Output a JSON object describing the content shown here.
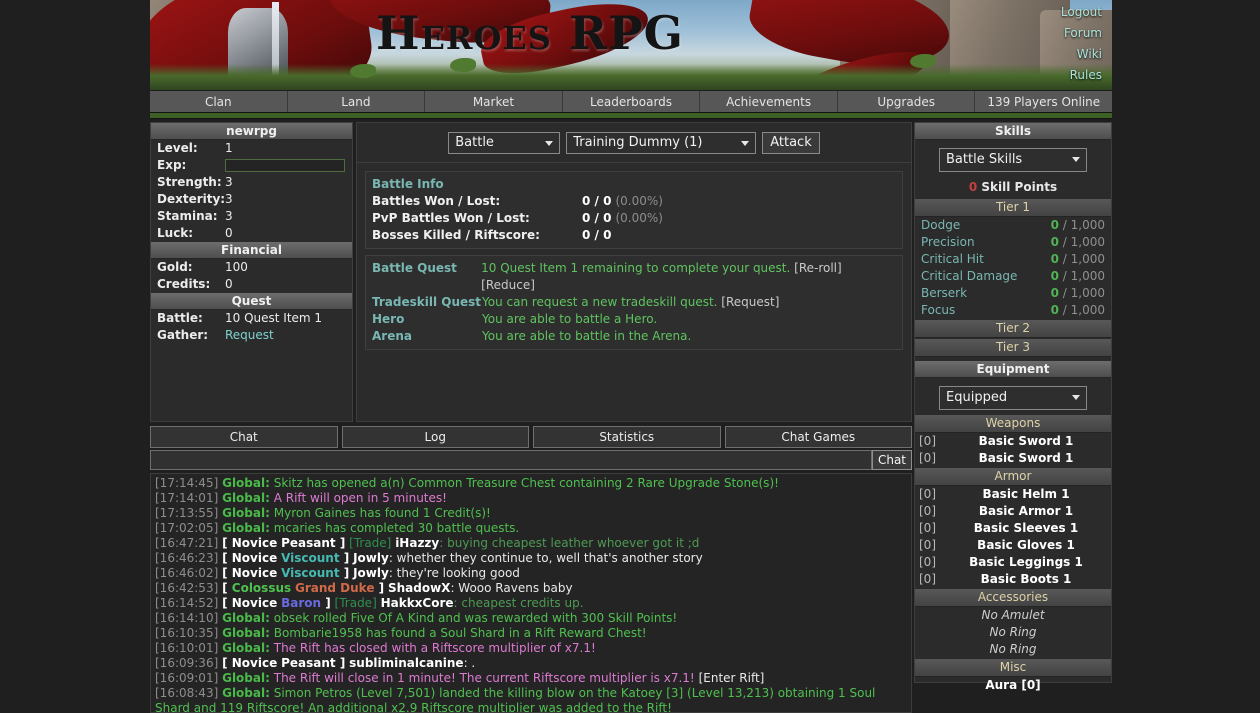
{
  "site": {
    "title": "Heroes RPG"
  },
  "header_links": [
    {
      "label": "Logout"
    },
    {
      "label": "Forum"
    },
    {
      "label": "Wiki"
    },
    {
      "label": "Rules"
    }
  ],
  "nav": [
    {
      "label": "Clan"
    },
    {
      "label": "Land"
    },
    {
      "label": "Market"
    },
    {
      "label": "Leaderboards"
    },
    {
      "label": "Achievements"
    },
    {
      "label": "Upgrades"
    },
    {
      "label": "139 Players Online"
    }
  ],
  "character": {
    "name": "newrpg",
    "stats": [
      {
        "label": "Level:",
        "value": "1"
      },
      {
        "label": "Exp:",
        "value": ""
      },
      {
        "label": "Strength:",
        "value": "3"
      },
      {
        "label": "Dexterity:",
        "value": "3"
      },
      {
        "label": "Stamina:",
        "value": "3"
      },
      {
        "label": "Luck:",
        "value": "0"
      }
    ],
    "financial_header": "Financial",
    "financial": [
      {
        "label": "Gold:",
        "value": "100"
      },
      {
        "label": "Credits:",
        "value": "0"
      }
    ],
    "quest_header": "Quest",
    "quest": [
      {
        "label": "Battle:",
        "value": "10 Quest Item 1",
        "link": false
      },
      {
        "label": "Gather:",
        "value": "Request",
        "link": true
      }
    ]
  },
  "battle": {
    "mode_select": "Battle",
    "target_select": "Training Dummy (1)",
    "attack_label": "Attack",
    "info_title": "Battle Info",
    "info_rows": [
      {
        "label": "Battles Won / Lost:",
        "value": "0 / 0",
        "pct": "(0.00%)"
      },
      {
        "label": "PvP Battles Won / Lost:",
        "value": "0 / 0",
        "pct": "(0.00%)"
      },
      {
        "label": "Bosses Killed / Riftscore:",
        "value": "0 / 0",
        "pct": ""
      }
    ],
    "quest_rows": [
      {
        "label": "Battle Quest",
        "text": "10 Quest Item 1 remaining to complete your quest.",
        "links": [
          "[Re-roll]",
          "[Reduce]"
        ]
      },
      {
        "label": "Tradeskill Quest",
        "text": "You can request a new tradeskill quest.",
        "links": [
          "[Request]"
        ]
      },
      {
        "label": "Hero",
        "text": "You are able to battle a Hero.",
        "links": []
      },
      {
        "label": "Arena",
        "text": "You are able to battle in the Arena.",
        "links": []
      }
    ]
  },
  "skills": {
    "header": "Skills",
    "selected": "Battle Skills",
    "points_value": "0",
    "points_label": "Skill Points",
    "tiers": [
      {
        "name": "Tier 1",
        "skills": [
          {
            "name": "Dodge",
            "current": "0",
            "max": "1,000"
          },
          {
            "name": "Precision",
            "current": "0",
            "max": "1,000"
          },
          {
            "name": "Critical Hit",
            "current": "0",
            "max": "1,000"
          },
          {
            "name": "Critical Damage",
            "current": "0",
            "max": "1,000"
          },
          {
            "name": "Berserk",
            "current": "0",
            "max": "1,000"
          },
          {
            "name": "Focus",
            "current": "0",
            "max": "1,000"
          }
        ]
      },
      {
        "name": "Tier 2",
        "skills": []
      },
      {
        "name": "Tier 3",
        "skills": []
      }
    ]
  },
  "equipment": {
    "header": "Equipment",
    "selected": "Equipped",
    "groups": [
      {
        "name": "Weapons",
        "items": [
          {
            "qty": "[0]",
            "name": "Basic Sword 1",
            "empty": false
          },
          {
            "qty": "[0]",
            "name": "Basic Sword 1",
            "empty": false
          }
        ]
      },
      {
        "name": "Armor",
        "items": [
          {
            "qty": "[0]",
            "name": "Basic Helm 1",
            "empty": false
          },
          {
            "qty": "[0]",
            "name": "Basic Armor 1",
            "empty": false
          },
          {
            "qty": "[0]",
            "name": "Basic Sleeves 1",
            "empty": false
          },
          {
            "qty": "[0]",
            "name": "Basic Gloves 1",
            "empty": false
          },
          {
            "qty": "[0]",
            "name": "Basic Leggings 1",
            "empty": false
          },
          {
            "qty": "[0]",
            "name": "Basic Boots 1",
            "empty": false
          }
        ]
      },
      {
        "name": "Accessories",
        "items": [
          {
            "qty": "",
            "name": "No Amulet",
            "empty": true
          },
          {
            "qty": "",
            "name": "No Ring",
            "empty": true
          },
          {
            "qty": "",
            "name": "No Ring",
            "empty": true
          }
        ]
      },
      {
        "name": "Misc",
        "items": [
          {
            "qty": "",
            "name": "Aura [0]",
            "empty": false
          }
        ]
      }
    ]
  },
  "chat": {
    "tabs": [
      {
        "label": "Chat"
      },
      {
        "label": "Log"
      },
      {
        "label": "Statistics"
      },
      {
        "label": "Chat Games"
      }
    ],
    "input_value": "",
    "input_placeholder": "",
    "send_label": "Chat",
    "messages": [
      {
        "ts": "[17:14:45]",
        "kind": "global",
        "prefix": "Global:",
        "text": "Skitz has opened a(n) Common Treasure Chest containing 2 Rare Upgrade Stone(s)!",
        "style": "green"
      },
      {
        "ts": "[17:14:01]",
        "kind": "global",
        "prefix": "Global:",
        "text": "A Rift will open in 5 minutes!",
        "style": "pink"
      },
      {
        "ts": "[17:13:55]",
        "kind": "global",
        "prefix": "Global:",
        "text": "Myron Gaines has found 1 Credit(s)!",
        "style": "green"
      },
      {
        "ts": "[17:02:05]",
        "kind": "global",
        "prefix": "Global:",
        "text": "mcaries has completed 30 battle quests.",
        "style": "green"
      },
      {
        "ts": "[16:47:21]",
        "kind": "player",
        "rank": "Novice",
        "title": "Peasant",
        "title_color": "#ffffff",
        "channel": "[Trade]",
        "user": "iHazzy",
        "text": "buying cheapest leather whoever got it ;d",
        "style": "trade"
      },
      {
        "ts": "[16:46:23]",
        "kind": "player",
        "rank": "Novice",
        "title": "Viscount",
        "title_color": "#46b9b0",
        "channel": "",
        "user": "Jowly",
        "text": "whether they continue to, well that's another story",
        "style": "plain"
      },
      {
        "ts": "[16:46:02]",
        "kind": "player",
        "rank": "Novice",
        "title": "Viscount",
        "title_color": "#46b9b0",
        "channel": "",
        "user": "Jowly",
        "text": "they're looking good",
        "style": "plain"
      },
      {
        "ts": "[16:42:53]",
        "kind": "player",
        "rank": "Colossus",
        "title": "Grand Duke",
        "title_color": "#cf6a4a",
        "rank_color": "#4fc04f",
        "channel": "",
        "user": "ShadowX",
        "text": "Wooo Ravens baby",
        "style": "plain"
      },
      {
        "ts": "[16:14:52]",
        "kind": "player",
        "rank": "Novice",
        "title": "Baron",
        "title_color": "#6a6ae0",
        "channel": "[Trade]",
        "user": "HakkxCore",
        "text": "cheapest credits up.",
        "style": "trade"
      },
      {
        "ts": "[16:14:10]",
        "kind": "global",
        "prefix": "Global:",
        "text": "obsek rolled Five Of A Kind and was rewarded with 300 Skill Points!",
        "style": "green"
      },
      {
        "ts": "[16:10:35]",
        "kind": "global",
        "prefix": "Global:",
        "text": "Bombarie1958 has found a Soul Shard in a Rift Reward Chest!",
        "style": "green"
      },
      {
        "ts": "[16:10:01]",
        "kind": "global",
        "prefix": "Global:",
        "text": "The Rift has closed with a Riftscore multiplier of x7.1!",
        "style": "pink"
      },
      {
        "ts": "[16:09:36]",
        "kind": "player",
        "rank": "Novice",
        "title": "Peasant",
        "title_color": "#ffffff",
        "channel": "",
        "user": "subliminalcanine",
        "text": ".",
        "style": "plain"
      },
      {
        "ts": "[16:09:01]",
        "kind": "global",
        "prefix": "Global:",
        "text": "The Rift will close in 1 minute! The current Riftscore multiplier is x7.1!",
        "style": "pink",
        "suffix_link": "[Enter Rift]"
      },
      {
        "ts": "[16:08:43]",
        "kind": "global",
        "prefix": "Global:",
        "text": "Simon Petros (Level 7,501) landed the killing blow on the Katoey [3] (Level 13,213) obtaining 1 Soul Shard and 119 Riftscore! An additional x2.9 Riftscore multiplier was added to the Rift!",
        "style": "green"
      }
    ]
  }
}
